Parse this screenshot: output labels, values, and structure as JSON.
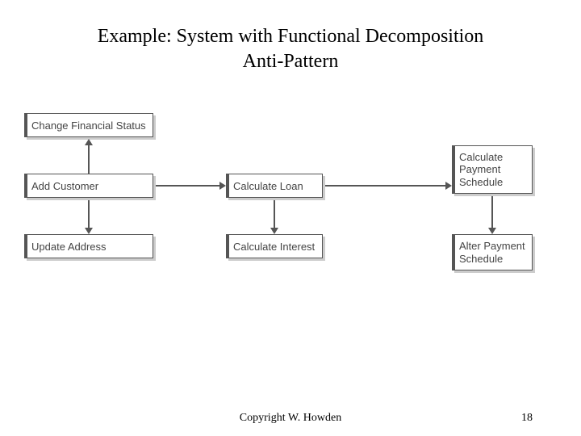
{
  "title_line1": "Example: System with Functional Decomposition",
  "title_line2": "Anti-Pattern",
  "boxes": {
    "change_financial_status": "Change Financial Status",
    "add_customer": "Add Customer",
    "update_address": "Update Address",
    "calculate_loan": "Calculate Loan",
    "calculate_interest": "Calculate Interest",
    "calculate_payment_schedule": "Calculate\nPayment\nSchedule",
    "alter_payment_schedule": "Alter Payment\nSchedule"
  },
  "footer": {
    "copyright": "Copyright W. Howden",
    "page": "18"
  }
}
